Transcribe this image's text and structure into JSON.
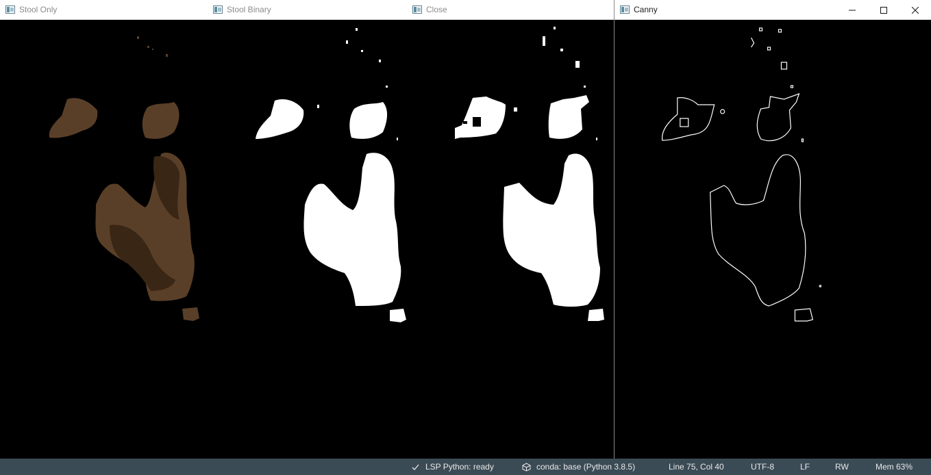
{
  "windows": [
    {
      "title": "Stool Only",
      "icon": "app-window-icon"
    },
    {
      "title": "Stool Binary",
      "icon": "app-window-icon"
    },
    {
      "title": "Close",
      "icon": "app-window-icon"
    },
    {
      "title": "Canny",
      "icon": "app-window-icon",
      "controls": [
        "minimize-icon",
        "maximize-icon",
        "close-icon"
      ]
    }
  ],
  "statusbar": {
    "lsp": "LSP Python: ready",
    "conda": "conda: base (Python 3.8.5)",
    "position": "Line 75, Col 40",
    "encoding": "UTF-8",
    "eol": "LF",
    "permissions": "RW",
    "memory": "Mem 63%"
  },
  "colors": {
    "statusbar_bg": "#3b4b56",
    "stool_brown": "#5a3f28",
    "mask_white": "#ffffff",
    "canvas_black": "#000000"
  }
}
